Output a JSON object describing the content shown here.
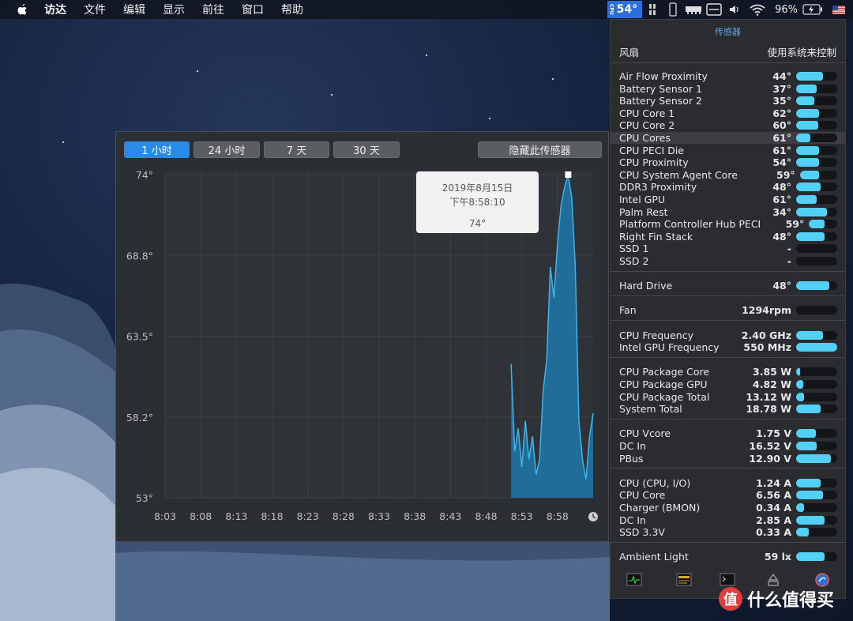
{
  "menubar": {
    "items": [
      "访达",
      "文件",
      "编辑",
      "显示",
      "前往",
      "窗口",
      "帮助"
    ],
    "temp": "54°",
    "temp_chip_label": "CPU",
    "battery": "96%"
  },
  "graph": {
    "tabs": [
      "1 小时",
      "24 小时",
      "7 天",
      "30 天"
    ],
    "active_tab": 0,
    "hide_button": "隐藏此传感器",
    "y_labels": [
      "74°",
      "68.8°",
      "63.5°",
      "58.2°",
      "53°"
    ],
    "x_labels": [
      "8:03",
      "8:08",
      "8:13",
      "8:18",
      "8:23",
      "8:28",
      "8:33",
      "8:38",
      "8:43",
      "8:48",
      "8:53",
      "8:58"
    ],
    "tooltip": {
      "date": "2019年8月15日",
      "time": "下午8:58:10",
      "value": "74°"
    },
    "colors": {
      "fill": "#1f6d98",
      "line": "#3eb4ea",
      "accent": "#2a8ae8"
    }
  },
  "chart_data": {
    "type": "area",
    "title": "",
    "xlabel": "",
    "ylabel": "",
    "ylim": [
      53,
      74
    ],
    "x_range": [
      "8:03",
      "9:03"
    ],
    "series": [
      {
        "x_minutes": [
          48.5,
          49.0,
          49.5,
          50.0,
          50.5,
          51.0,
          51.5,
          52.0,
          52.5,
          53.0,
          53.5,
          54.0,
          54.5,
          55.0,
          55.5,
          56.0,
          56.5,
          57.0,
          57.5,
          58.0,
          58.5,
          59.0,
          59.5,
          60.0
        ],
        "values": [
          61.7,
          56.0,
          57.5,
          55.0,
          58.0,
          55.5,
          57.0,
          54.5,
          55.5,
          60.0,
          62.0,
          68.0,
          66.0,
          69.5,
          72.0,
          73.2,
          74.0,
          72.5,
          68.0,
          58.0,
          55.5,
          54.2,
          57.0,
          58.5
        ]
      }
    ]
  },
  "sensors": {
    "title": "传感器",
    "fan_label": "风扇",
    "fan_mode": "使用系统来控制",
    "groups": [
      [
        {
          "name": "Air Flow Proximity",
          "value": "44°",
          "pct": 0.65
        },
        {
          "name": "Battery Sensor 1",
          "value": "37°",
          "pct": 0.5
        },
        {
          "name": "Battery Sensor 2",
          "value": "35°",
          "pct": 0.45
        },
        {
          "name": "CPU Core 1",
          "value": "62°",
          "pct": 0.55
        },
        {
          "name": "CPU Core 2",
          "value": "60°",
          "pct": 0.53
        },
        {
          "name": "CPU Cores",
          "value": "61°",
          "pct": 0.35
        },
        {
          "name": "CPU PECI Die",
          "value": "61°",
          "pct": 0.55
        },
        {
          "name": "CPU Proximity",
          "value": "54°",
          "pct": 0.55
        },
        {
          "name": "CPU System Agent Core",
          "value": "59°",
          "pct": 0.52
        },
        {
          "name": "DDR3 Proximity",
          "value": "48°",
          "pct": 0.6
        },
        {
          "name": "Intel GPU",
          "value": "61°",
          "pct": 0.5
        },
        {
          "name": "Palm Rest",
          "value": "34°",
          "pct": 0.75
        },
        {
          "name": "Platform Controller Hub PECI",
          "value": "59°",
          "pct": 0.55
        },
        {
          "name": "Right Fin Stack",
          "value": "48°",
          "pct": 0.7
        },
        {
          "name": "SSD 1",
          "value": "-",
          "pct": 0
        },
        {
          "name": "SSD 2",
          "value": "-",
          "pct": 0
        }
      ],
      [
        {
          "name": "Hard Drive",
          "value": "48°",
          "pct": 0.8
        }
      ],
      [
        {
          "name": "Fan",
          "value": "1294rpm",
          "pct": 0
        }
      ],
      [
        {
          "name": "CPU Frequency",
          "value": "2.40 GHz",
          "pct": 0.65
        },
        {
          "name": "Intel GPU Frequency",
          "value": "550 MHz",
          "pct": 1.0
        }
      ],
      [
        {
          "name": "CPU Package Core",
          "value": "3.85 W",
          "pct": 0.1
        },
        {
          "name": "CPU Package GPU",
          "value": "4.82 W",
          "pct": 0.18
        },
        {
          "name": "CPU Package Total",
          "value": "13.12 W",
          "pct": 0.2
        },
        {
          "name": "System Total",
          "value": "18.78 W",
          "pct": 0.6
        }
      ],
      [
        {
          "name": "CPU Vcore",
          "value": "1.75 V",
          "pct": 0.48
        },
        {
          "name": "DC In",
          "value": "16.52 V",
          "pct": 0.5
        },
        {
          "name": "PBus",
          "value": "12.90 V",
          "pct": 0.85
        }
      ],
      [
        {
          "name": "CPU (CPU, I/O)",
          "value": "1.24 A",
          "pct": 0.6
        },
        {
          "name": "CPU Core",
          "value": "6.56 A",
          "pct": 0.65
        },
        {
          "name": "Charger (BMON)",
          "value": "0.34 A",
          "pct": 0.2
        },
        {
          "name": "DC In",
          "value": "2.85 A",
          "pct": 0.7
        },
        {
          "name": "SSD 3.3V",
          "value": "0.33 A",
          "pct": 0.3
        }
      ],
      [
        {
          "name": "Ambient Light",
          "value": "59 lx",
          "pct": 0.7
        }
      ]
    ],
    "highlight": "CPU Cores"
  },
  "watermark": {
    "text": "什么值得买",
    "logo": "值"
  }
}
